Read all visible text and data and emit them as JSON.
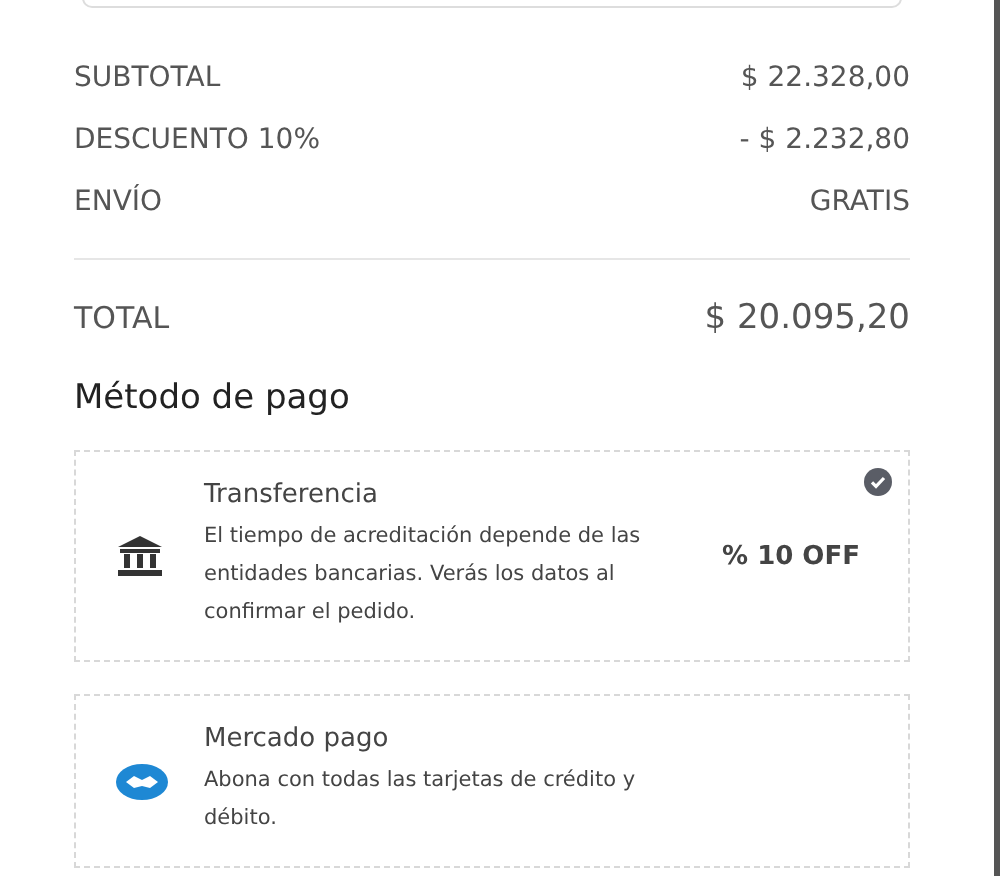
{
  "summary": [
    {
      "label": "SUBTOTAL",
      "value": "$ 22.328,00"
    },
    {
      "label": "DESCUENTO 10%",
      "value": "- $ 2.232,80"
    },
    {
      "label": "ENVÍO",
      "value": "GRATIS"
    }
  ],
  "total": {
    "label": "TOTAL",
    "value": "$ 20.095,20"
  },
  "payment_title": "Método de pago",
  "methods": [
    {
      "kind": "bank",
      "name": "Transferencia",
      "description": "El tiempo de acreditación depende de las entidades bancarias. Verás los datos al confirmar el pedido.",
      "badge": "% 10 OFF",
      "selected": true
    },
    {
      "kind": "handshake",
      "name": "Mercado pago",
      "description": "Abona con todas las tarjetas de crédito y débito.",
      "selected": false
    }
  ]
}
